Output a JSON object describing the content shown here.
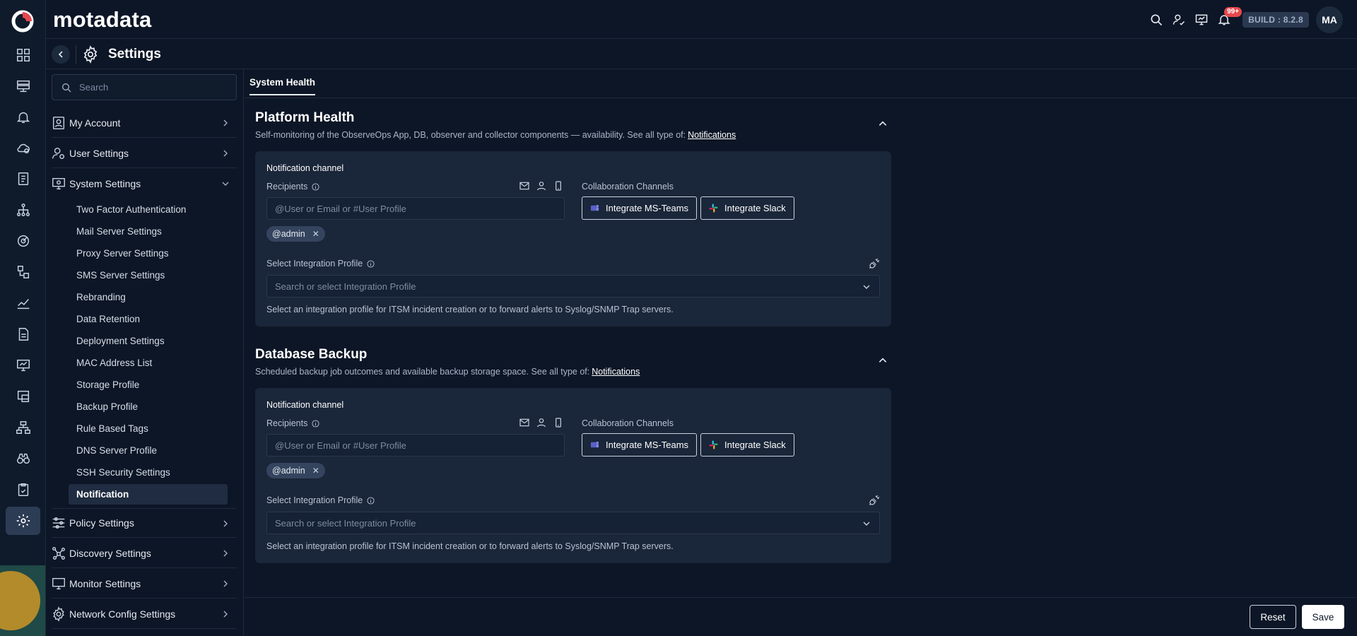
{
  "app": {
    "brand": "motadata",
    "build": "BUILD : 8.2.8",
    "notification_count": "99+",
    "avatar_initials": "MA"
  },
  "rail": {
    "icons": [
      "dashboard-icon",
      "server-stack-icon",
      "bell-icon",
      "cloud-alert-icon",
      "report-book-icon",
      "topology-icon",
      "radar-icon",
      "workflow-icon",
      "chart-icon",
      "document-icon",
      "monitor-icon",
      "device-icon",
      "hierarchy-icon",
      "binoculars-icon",
      "clipboard-icon",
      "settings-icon"
    ],
    "active": "settings-icon"
  },
  "page": {
    "title": "Settings"
  },
  "sidebar": {
    "search_placeholder": "Search",
    "groups": [
      {
        "label": "My Account",
        "icon": "user-card-icon",
        "expanded": false
      },
      {
        "label": "User Settings",
        "icon": "user-gear-icon",
        "expanded": false
      },
      {
        "label": "System Settings",
        "icon": "system-gear-icon",
        "expanded": true
      },
      {
        "label": "Policy Settings",
        "icon": "sliders-icon",
        "expanded": false
      },
      {
        "label": "Discovery Settings",
        "icon": "network-icon",
        "expanded": false
      },
      {
        "label": "Monitor Settings",
        "icon": "monitor-icon",
        "expanded": false
      },
      {
        "label": "Network Config Settings",
        "icon": "network-gear-icon",
        "expanded": false
      }
    ],
    "system_items": [
      "Two Factor Authentication",
      "Mail Server Settings",
      "Proxy Server Settings",
      "SMS Server Settings",
      "Rebranding",
      "Data Retention",
      "Deployment Settings",
      "MAC Address List",
      "Storage Profile",
      "Backup Profile",
      "Rule Based Tags",
      "DNS Server Profile",
      "SSH Security Settings",
      "Notification"
    ],
    "active_item": "Notification"
  },
  "tabs": [
    {
      "label": "System Health",
      "active": true
    }
  ],
  "sections": [
    {
      "title": "Platform Health",
      "description": "Self-monitoring of the ObserveOps App, DB, observer and collector components — availability. See all type of:",
      "link": "Notifications",
      "notification_channel": "Notification channel",
      "recipients_label": "Recipients",
      "recipients_placeholder": "@User or Email or #User Profile",
      "chip": "@admin",
      "collab_label": "Collaboration Channels",
      "teams_button": "Integrate MS-Teams",
      "slack_button": "Integrate Slack",
      "integration_label": "Select Integration Profile",
      "integration_placeholder": "Search or select Integration Profile",
      "help": "Select an integration profile for ITSM incident creation or to forward alerts to Syslog/SNMP Trap servers."
    },
    {
      "title": "Database Backup",
      "description": "Scheduled backup job outcomes and available backup storage space. See all type of:",
      "link": "Notifications",
      "notification_channel": "Notification channel",
      "recipients_label": "Recipients",
      "recipients_placeholder": "@User or Email or #User Profile",
      "chip": "@admin",
      "collab_label": "Collaboration Channels",
      "teams_button": "Integrate MS-Teams",
      "slack_button": "Integrate Slack",
      "integration_label": "Select Integration Profile",
      "integration_placeholder": "Search or select Integration Profile",
      "help": "Select an integration profile for ITSM incident creation or to forward alerts to Syslog/SNMP Trap servers."
    }
  ],
  "footer": {
    "reset": "Reset",
    "save": "Save"
  },
  "colors": {
    "background": "#0d1626",
    "card": "#1a2639",
    "badge": "#e5484d",
    "accent": "#ffffff"
  }
}
